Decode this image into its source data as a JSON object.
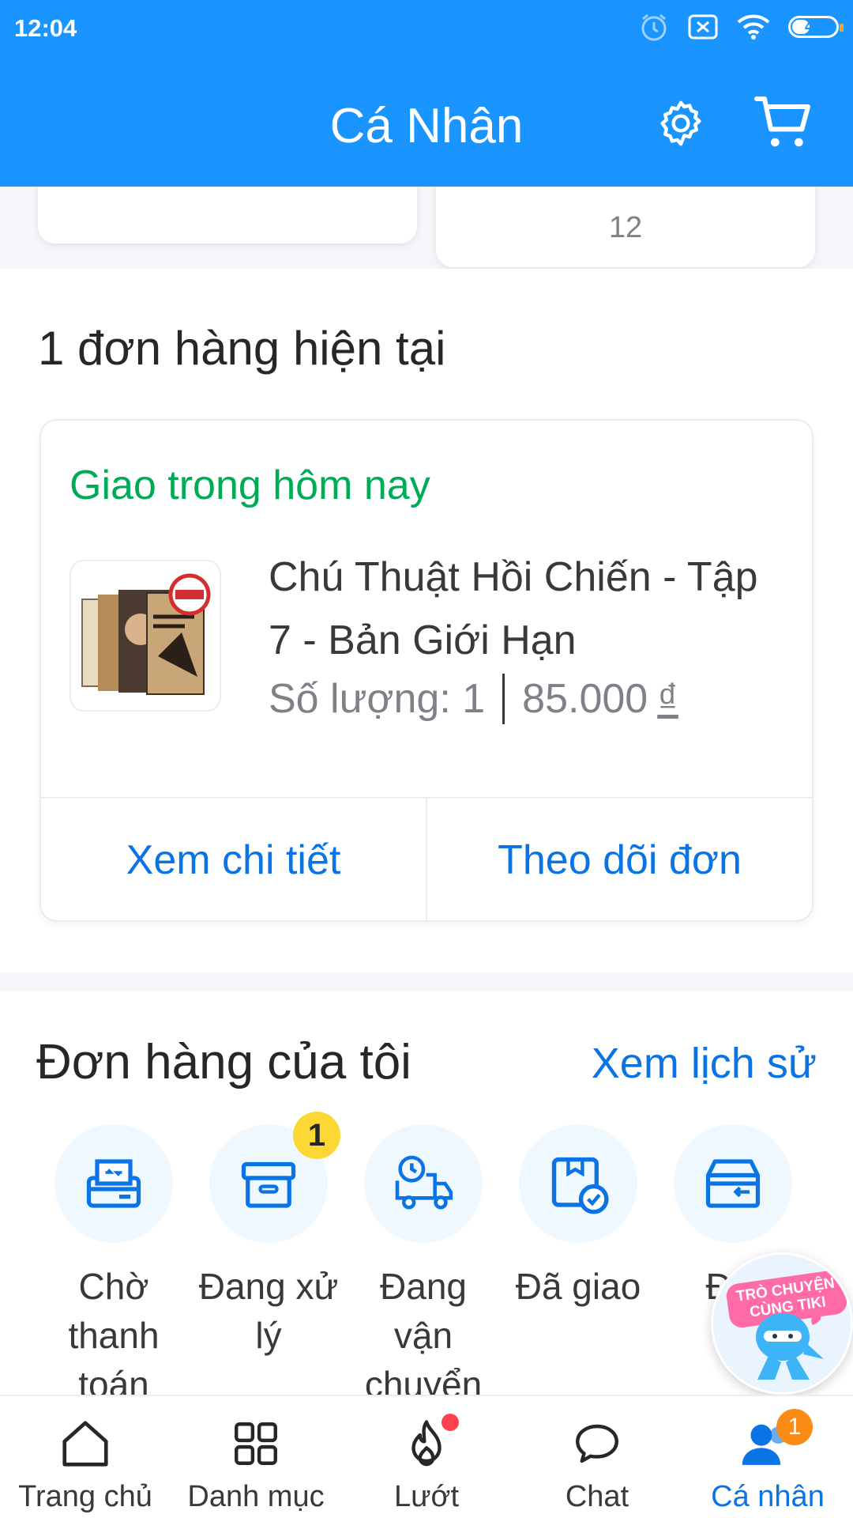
{
  "status_bar": {
    "time": "12:04",
    "battery": "45",
    "battery_level": 0.45
  },
  "header": {
    "title": "Cá Nhân",
    "settings_icon": "gear-icon",
    "cart_icon": "cart-icon",
    "color": "#1a94ff"
  },
  "top_cards": {
    "partial_value": "12"
  },
  "current_orders": {
    "title": "1 đơn hàng hiện tại",
    "card": {
      "status": "Giao trong hôm nay",
      "product_name": "Chú Thuật Hồi Chiến - Tập 7 - Bản Giới Hạn",
      "quantity_label": "Số lượng: 1",
      "price": "85.000",
      "currency": "₫",
      "view_detail": "Xem chi tiết",
      "track_order": "Theo dõi đơn"
    }
  },
  "my_orders": {
    "title": "Đơn hàng của tôi",
    "history_link": "Xem lịch sử",
    "states": [
      {
        "label": "Chờ thanh toán",
        "icon": "payment-pending-icon"
      },
      {
        "label": "Đang xử lý",
        "icon": "box-icon",
        "badge": "1"
      },
      {
        "label": "Đang vận chuyển",
        "icon": "delivery-truck-icon"
      },
      {
        "label": "Đã giao",
        "icon": "delivered-box-icon"
      },
      {
        "label": "Đổi",
        "icon": "return-box-icon"
      }
    ]
  },
  "chat_bubble": {
    "text": "TRÒ CHUYỆN CÙNG TIKI"
  },
  "bottom_nav": {
    "items": [
      {
        "label": "Trang chủ",
        "icon": "home-icon"
      },
      {
        "label": "Danh mục",
        "icon": "grid-icon"
      },
      {
        "label": "Lướt",
        "icon": "flame-icon"
      },
      {
        "label": "Chat",
        "icon": "chat-icon"
      },
      {
        "label": "Cá nhân",
        "icon": "user-icon",
        "badge": "1",
        "active": true
      }
    ]
  },
  "colors": {
    "primary": "#1a94ff",
    "link": "#0b74e5",
    "success": "#00ab56",
    "badge_yellow": "#fdd835",
    "badge_orange": "#fa8c16"
  }
}
